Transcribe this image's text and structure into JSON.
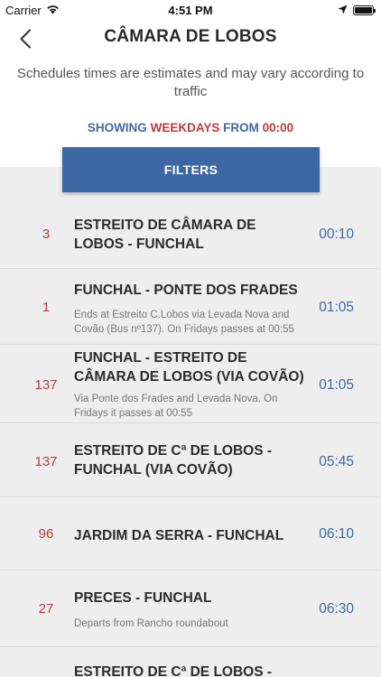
{
  "status_bar": {
    "carrier": "Carrier",
    "time": "4:51 PM",
    "battery_level": 1.0
  },
  "header": {
    "title": "CÂMARA DE LOBOS",
    "back_icon": "chevron-left-icon"
  },
  "notice": "Schedules times are estimates and may vary according to traffic",
  "showing": {
    "prefix": "SHOWING",
    "day": "WEEKDAYS",
    "from": "FROM",
    "time": "00:00"
  },
  "filters_label": "FILTERS",
  "colors": {
    "accent_blue": "#3b67a2",
    "accent_red": "#c0393a"
  },
  "schedules": [
    {
      "line": "3",
      "route": "ESTREITO DE CÂMARA DE LOBOS - FUNCHAL",
      "note": "",
      "time": "00:10"
    },
    {
      "line": "1",
      "route": "FUNCHAL - PONTE DOS FRADES",
      "note": "Ends at Estreito C.Lobos via Levada Nova and Covão (Bus nº137). On Fridays passes at 00:55",
      "time": "01:05"
    },
    {
      "line": "137",
      "route": "FUNCHAL - ESTREITO DE CÂMARA DE LOBOS (VIA COVÃO)",
      "note": "Via Ponte dos Frades and Levada Nova. On Fridays it passes at 00:55",
      "time": "01:05"
    },
    {
      "line": "137",
      "route": "ESTREITO DE Cª DE LOBOS - FUNCHAL (VIA COVÃO)",
      "note": "",
      "time": "05:45"
    },
    {
      "line": "96",
      "route": "JARDIM DA SERRA - FUNCHAL",
      "note": "",
      "time": "06:10"
    },
    {
      "line": "27",
      "route": "PRECES - FUNCHAL",
      "note": "Departs from Rancho roundabout",
      "time": "06:30"
    },
    {
      "line": "",
      "route": "ESTREITO DE Cª DE LOBOS -",
      "note": "",
      "time": ""
    }
  ]
}
